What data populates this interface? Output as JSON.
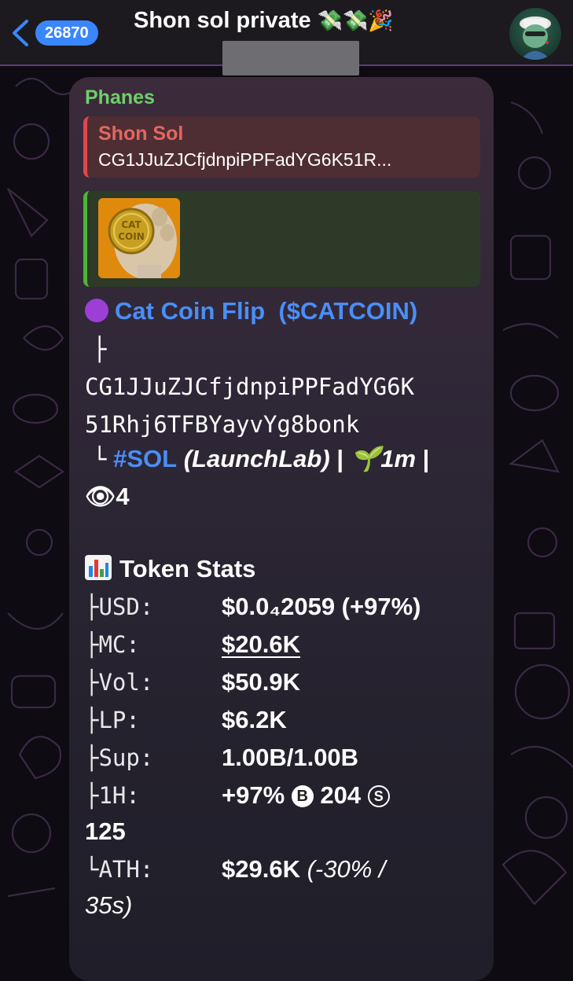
{
  "header": {
    "unread_count": "26870",
    "title": "Shon sol private",
    "title_emojis": "💸💸🎉",
    "back_icon": "chevron-left-icon",
    "accent": "#3a86ff"
  },
  "message": {
    "sender": "Phanes",
    "reply": {
      "name": "Shon Sol",
      "text": "CG1JJuZJCfjdnpiPPFadYG6K51R..."
    },
    "media_thumb_text": "CAT COIN",
    "token": {
      "name": "Cat Coin Flip",
      "ticker": "($CATCOIN)",
      "tree_top": "├",
      "address_line1": "CG1JJuZJCfjdnpiPPFadYG6K",
      "address_line2": "51Rhj6TFBYayvYg8bonk",
      "tree_end": "└",
      "chain_tag": "#SOL",
      "platform": "(LaunchLab)",
      "sep1": "|",
      "age_emoji": "🌱",
      "age": "1m",
      "sep2": "|",
      "views_emoji": "👁",
      "views": "4"
    },
    "stats_title": "Token Stats",
    "stats": [
      {
        "label": "├USD:",
        "value": "$0.0₄2059 (+97%)"
      },
      {
        "label": "├MC:",
        "value": "$20.6K"
      },
      {
        "label": "├Vol:",
        "value": "$50.9K"
      },
      {
        "label": "├LP:",
        "value": "$6.2K"
      },
      {
        "label": "├Sup:",
        "value": "1.00B/1.00B"
      },
      {
        "label": "├1H:",
        "value_a": "+97%",
        "buy_icon": "B",
        "value_b": "204",
        "sell_icon": "S",
        "value_c": "125"
      },
      {
        "label": "└ATH:",
        "value": "$29.6K",
        "value_italic": "(-30% /",
        "value_italic_2": "35s)"
      }
    ],
    "colors": {
      "sender": "#6ed06a",
      "reply_accent": "#e0474a",
      "media_accent": "#4db538",
      "link": "#4a8ef5"
    }
  }
}
